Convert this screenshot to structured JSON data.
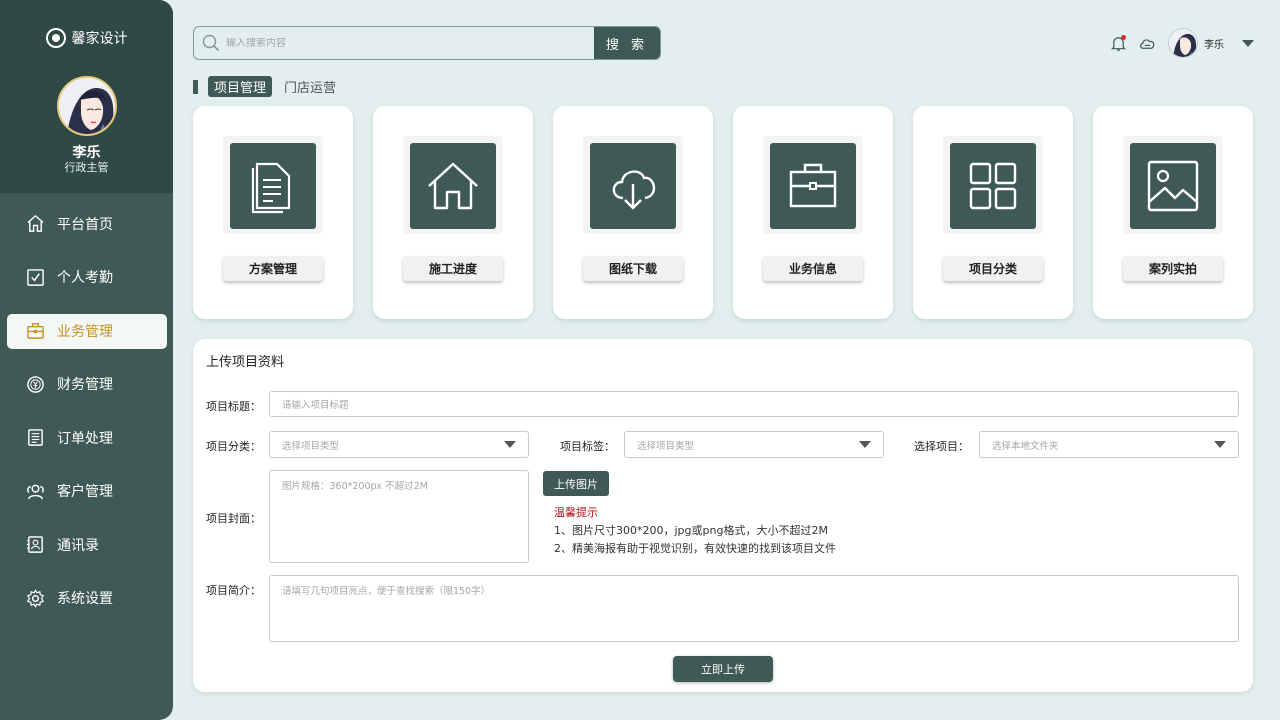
{
  "brand": {
    "name": "馨家设计"
  },
  "profile": {
    "name": "李乐",
    "role": "行政主管"
  },
  "nav": {
    "items": [
      {
        "label": "平台首页",
        "icon": "home-icon",
        "active": false
      },
      {
        "label": "个人考勤",
        "icon": "checkbox-icon",
        "active": false
      },
      {
        "label": "业务管理",
        "icon": "briefcase-icon",
        "active": true
      },
      {
        "label": "财务管理",
        "icon": "yuan-coin-icon",
        "active": false
      },
      {
        "label": "订单处理",
        "icon": "document-list-icon",
        "active": false
      },
      {
        "label": "客户管理",
        "icon": "users-icon",
        "active": false
      },
      {
        "label": "通讯录",
        "icon": "contact-card-icon",
        "active": false
      },
      {
        "label": "系统设置",
        "icon": "gear-icon",
        "active": false
      }
    ]
  },
  "search": {
    "placeholder": "输入搜索内容",
    "button_label": "搜 索"
  },
  "header": {
    "user_name": "李乐"
  },
  "tabs": [
    {
      "label": "项目管理",
      "active": true
    },
    {
      "label": "门店运营",
      "active": false
    }
  ],
  "cards": [
    {
      "label": "方案管理",
      "icon": "documents-icon"
    },
    {
      "label": "施工进度",
      "icon": "house-icon"
    },
    {
      "label": "图纸下载",
      "icon": "cloud-download-icon"
    },
    {
      "label": "业务信息",
      "icon": "briefcase-icon"
    },
    {
      "label": "项目分类",
      "icon": "grid-icon"
    },
    {
      "label": "案列实拍",
      "icon": "image-icon"
    }
  ],
  "form": {
    "title": "上传项目资料",
    "project_title": {
      "label": "项目标题：",
      "placeholder": "请输入项目标题"
    },
    "category": {
      "label": "项目分类：",
      "placeholder": "选择项目类型"
    },
    "tag": {
      "label": "项目标签：",
      "placeholder": "选择项目类型"
    },
    "select_project": {
      "label": "选择项目：",
      "placeholder": "选择本地文件夹"
    },
    "cover": {
      "label": "项目封面：",
      "placeholder": "图片规格：360*200px 不超过2M"
    },
    "upload_button": "上传图片",
    "tips": {
      "title": "温馨提示",
      "line1": "1、图片尺寸300*200，jpg或png格式，大小不超过2M",
      "line2": "2、精美海报有助于视觉识别，有效快速的找到该项目文件"
    },
    "intro": {
      "label": "项目简介：",
      "placeholder": "请填写几句项目亮点，便于查找搜索（限150字）"
    },
    "submit_button": "立即上传"
  },
  "colors": {
    "primary": "#3f5a55",
    "sidebar_top": "#2f4944",
    "background": "#e3efee",
    "active_nav_text": "#c49424",
    "tip_red": "#b3141b"
  }
}
